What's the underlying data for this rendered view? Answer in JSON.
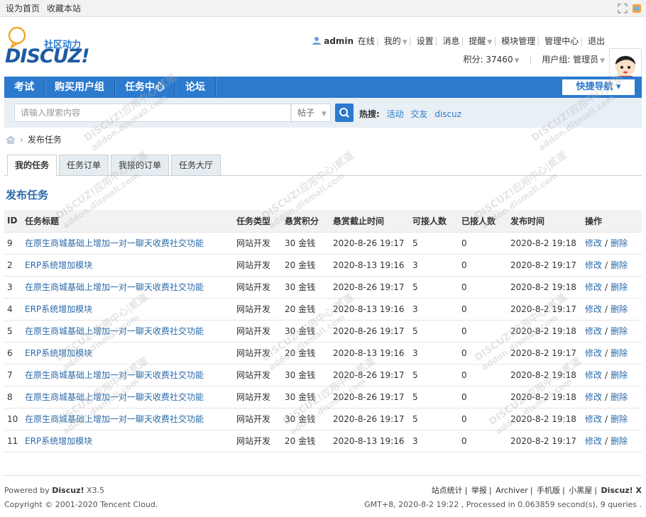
{
  "topbar": {
    "set_home": "设为首页",
    "bookmark": "收藏本站"
  },
  "logo": {
    "subtitle": "社区动力",
    "brand": "DISCUZ!"
  },
  "user": {
    "name": "admin",
    "status": "在线",
    "menu": [
      "我的",
      "设置",
      "消息",
      "提醒",
      "模块管理",
      "管理中心",
      "退出"
    ],
    "points_label": "积分: 37460",
    "group_label": "用户组: 管理员"
  },
  "nav": {
    "items": [
      "考试",
      "购买用户组",
      "任务中心",
      "论坛"
    ],
    "quick": "快捷导航 ▾"
  },
  "search": {
    "placeholder": "请输入搜索内容",
    "type": "帖子",
    "hot_label": "热搜:",
    "hot_terms": [
      "活动",
      "交友",
      "discuz"
    ]
  },
  "breadcrumb": {
    "current": "发布任务"
  },
  "tabs": [
    "我的任务",
    "任务订单",
    "我接的订单",
    "任务大厅"
  ],
  "section_title": "发布任务",
  "table": {
    "headers": [
      "ID",
      "任务标题",
      "任务类型",
      "悬赏积分",
      "悬赏截止时间",
      "可接人数",
      "已接人数",
      "发布时间",
      "操作"
    ],
    "edit_label": "修改",
    "delete_label": "删除",
    "slash": "/",
    "rows": [
      {
        "id": "9",
        "title": "在原生商城基础上增加一对一聊天收费社交功能",
        "type": "网站开发",
        "reward": "30 金钱",
        "deadline": "2020-8-26 19:17",
        "capacity": "5",
        "taken": "0",
        "published": "2020-8-2 19:18"
      },
      {
        "id": "2",
        "title": "ERP系统增加模块",
        "type": "网站开发",
        "reward": "20 金钱",
        "deadline": "2020-8-13 19:16",
        "capacity": "3",
        "taken": "0",
        "published": "2020-8-2 19:17"
      },
      {
        "id": "3",
        "title": "在原生商城基础上增加一对一聊天收费社交功能",
        "type": "网站开发",
        "reward": "30 金钱",
        "deadline": "2020-8-26 19:17",
        "capacity": "5",
        "taken": "0",
        "published": "2020-8-2 19:18"
      },
      {
        "id": "4",
        "title": "ERP系统增加模块",
        "type": "网站开发",
        "reward": "20 金钱",
        "deadline": "2020-8-13 19:16",
        "capacity": "3",
        "taken": "0",
        "published": "2020-8-2 19:17"
      },
      {
        "id": "5",
        "title": "在原生商城基础上增加一对一聊天收费社交功能",
        "type": "网站开发",
        "reward": "30 金钱",
        "deadline": "2020-8-26 19:17",
        "capacity": "5",
        "taken": "0",
        "published": "2020-8-2 19:18"
      },
      {
        "id": "6",
        "title": "ERP系统增加模块",
        "type": "网站开发",
        "reward": "20 金钱",
        "deadline": "2020-8-13 19:16",
        "capacity": "3",
        "taken": "0",
        "published": "2020-8-2 19:17"
      },
      {
        "id": "7",
        "title": "在原生商城基础上增加一对一聊天收费社交功能",
        "type": "网站开发",
        "reward": "30 金钱",
        "deadline": "2020-8-26 19:17",
        "capacity": "5",
        "taken": "0",
        "published": "2020-8-2 19:18"
      },
      {
        "id": "8",
        "title": "在原生商城基础上增加一对一聊天收费社交功能",
        "type": "网站开发",
        "reward": "30 金钱",
        "deadline": "2020-8-26 19:17",
        "capacity": "5",
        "taken": "0",
        "published": "2020-8-2 19:18"
      },
      {
        "id": "10",
        "title": "在原生商城基础上增加一对一聊天收费社交功能",
        "type": "网站开发",
        "reward": "30 金钱",
        "deadline": "2020-8-26 19:17",
        "capacity": "5",
        "taken": "0",
        "published": "2020-8-2 19:18"
      },
      {
        "id": "11",
        "title": "ERP系统增加模块",
        "type": "网站开发",
        "reward": "20 金钱",
        "deadline": "2020-8-13 19:16",
        "capacity": "3",
        "taken": "0",
        "published": "2020-8-2 19:17"
      }
    ]
  },
  "footer": {
    "powered_prefix": "Powered by ",
    "powered_brand": "Discuz!",
    "powered_version": " X3.5",
    "copyright": "Copyright © 2001-2020 Tencent Cloud.",
    "links": [
      "站点统计",
      "举报",
      "Archiver",
      "手机版",
      "小黑屋"
    ],
    "brand_right": "Discuz! X",
    "stats": "GMT+8, 2020-8-2 19:22 , Processed in 0.063859 second(s), 9 queries ."
  },
  "watermark": {
    "line1": "DISCUZ!应用中心|贰道",
    "line2": "addon.dismall.com"
  },
  "colors": {
    "primary": "#2b7acd",
    "link": "#2b6aa8",
    "search_bg": "#e8eff5"
  }
}
